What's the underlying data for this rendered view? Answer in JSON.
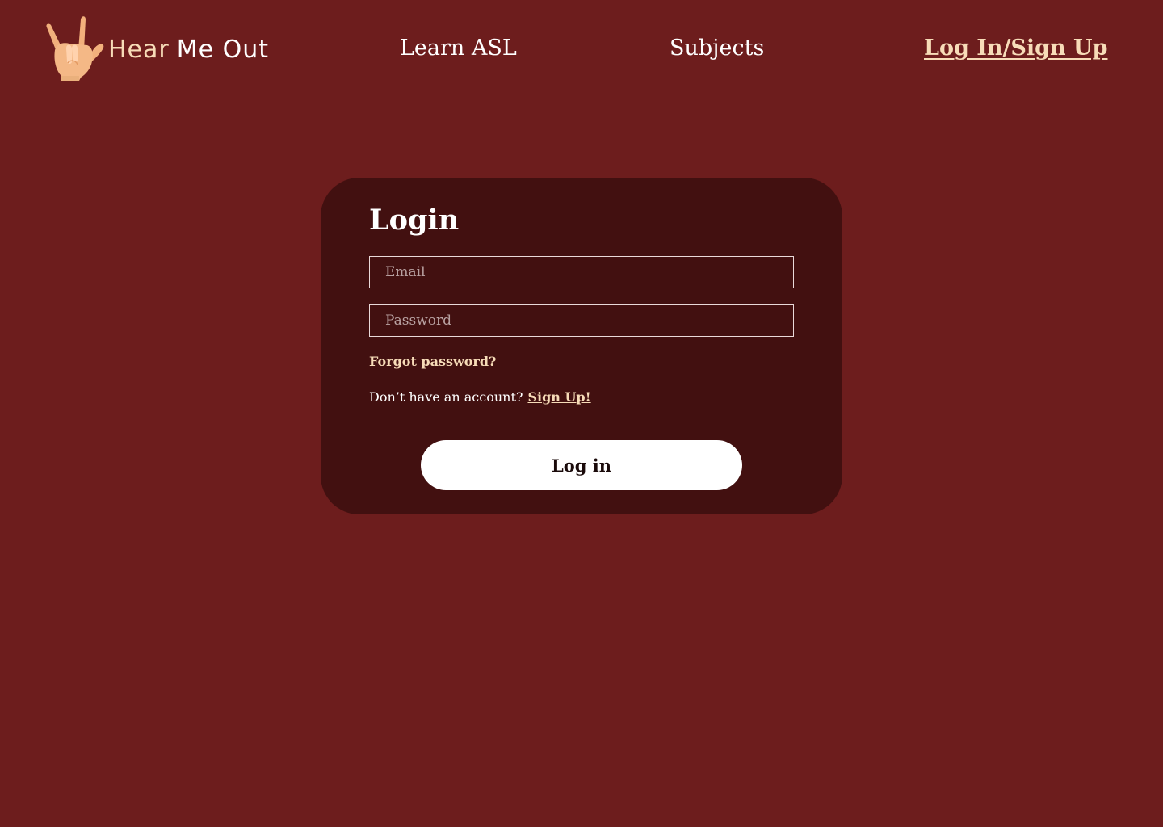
{
  "brand": {
    "name_part_a": "Hear",
    "name_part_b": "Me Out",
    "logo_icon": "sign-language-hand-icon"
  },
  "nav": {
    "learn_asl": "Learn ASL",
    "subjects": "Subjects",
    "login_signup": "Log In/Sign Up"
  },
  "login_card": {
    "title": "Login",
    "email_placeholder": "Email",
    "email_value": "",
    "password_placeholder": "Password",
    "password_value": "",
    "forgot_password": "Forgot password?",
    "no_account_prompt": "Don’t have an account?",
    "signup_link": "Sign Up!",
    "submit_label": "Log in"
  },
  "colors": {
    "page_background": "#6d1d1d",
    "card_background": "#421010",
    "accent": "#f7dcb8",
    "text": "#ffffff"
  }
}
